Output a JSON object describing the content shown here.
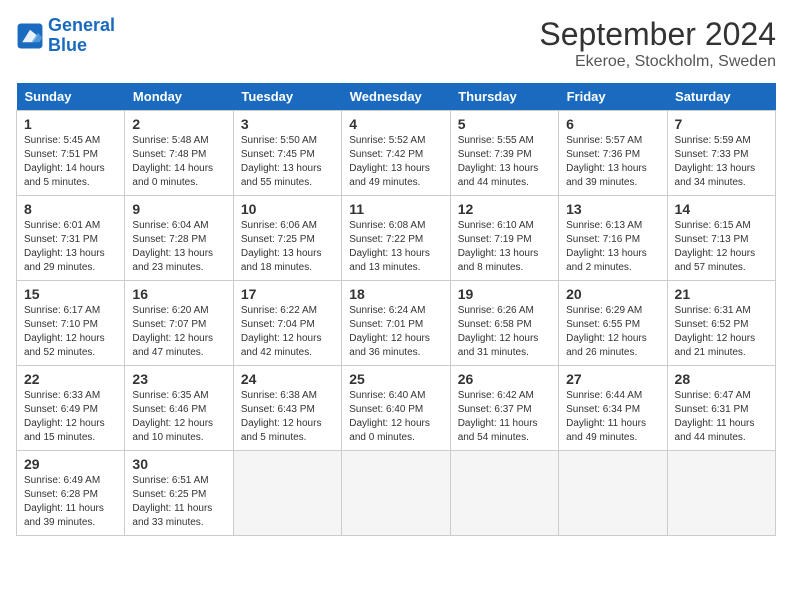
{
  "logo": {
    "line1": "General",
    "line2": "Blue"
  },
  "title": "September 2024",
  "location": "Ekeroe, Stockholm, Sweden",
  "days_of_week": [
    "Sunday",
    "Monday",
    "Tuesday",
    "Wednesday",
    "Thursday",
    "Friday",
    "Saturday"
  ],
  "weeks": [
    [
      {
        "num": "1",
        "sunrise": "5:45 AM",
        "sunset": "7:51 PM",
        "daylight": "14 hours and 5 minutes."
      },
      {
        "num": "2",
        "sunrise": "5:48 AM",
        "sunset": "7:48 PM",
        "daylight": "14 hours and 0 minutes."
      },
      {
        "num": "3",
        "sunrise": "5:50 AM",
        "sunset": "7:45 PM",
        "daylight": "13 hours and 55 minutes."
      },
      {
        "num": "4",
        "sunrise": "5:52 AM",
        "sunset": "7:42 PM",
        "daylight": "13 hours and 49 minutes."
      },
      {
        "num": "5",
        "sunrise": "5:55 AM",
        "sunset": "7:39 PM",
        "daylight": "13 hours and 44 minutes."
      },
      {
        "num": "6",
        "sunrise": "5:57 AM",
        "sunset": "7:36 PM",
        "daylight": "13 hours and 39 minutes."
      },
      {
        "num": "7",
        "sunrise": "5:59 AM",
        "sunset": "7:33 PM",
        "daylight": "13 hours and 34 minutes."
      }
    ],
    [
      {
        "num": "8",
        "sunrise": "6:01 AM",
        "sunset": "7:31 PM",
        "daylight": "13 hours and 29 minutes."
      },
      {
        "num": "9",
        "sunrise": "6:04 AM",
        "sunset": "7:28 PM",
        "daylight": "13 hours and 23 minutes."
      },
      {
        "num": "10",
        "sunrise": "6:06 AM",
        "sunset": "7:25 PM",
        "daylight": "13 hours and 18 minutes."
      },
      {
        "num": "11",
        "sunrise": "6:08 AM",
        "sunset": "7:22 PM",
        "daylight": "13 hours and 13 minutes."
      },
      {
        "num": "12",
        "sunrise": "6:10 AM",
        "sunset": "7:19 PM",
        "daylight": "13 hours and 8 minutes."
      },
      {
        "num": "13",
        "sunrise": "6:13 AM",
        "sunset": "7:16 PM",
        "daylight": "13 hours and 2 minutes."
      },
      {
        "num": "14",
        "sunrise": "6:15 AM",
        "sunset": "7:13 PM",
        "daylight": "12 hours and 57 minutes."
      }
    ],
    [
      {
        "num": "15",
        "sunrise": "6:17 AM",
        "sunset": "7:10 PM",
        "daylight": "12 hours and 52 minutes."
      },
      {
        "num": "16",
        "sunrise": "6:20 AM",
        "sunset": "7:07 PM",
        "daylight": "12 hours and 47 minutes."
      },
      {
        "num": "17",
        "sunrise": "6:22 AM",
        "sunset": "7:04 PM",
        "daylight": "12 hours and 42 minutes."
      },
      {
        "num": "18",
        "sunrise": "6:24 AM",
        "sunset": "7:01 PM",
        "daylight": "12 hours and 36 minutes."
      },
      {
        "num": "19",
        "sunrise": "6:26 AM",
        "sunset": "6:58 PM",
        "daylight": "12 hours and 31 minutes."
      },
      {
        "num": "20",
        "sunrise": "6:29 AM",
        "sunset": "6:55 PM",
        "daylight": "12 hours and 26 minutes."
      },
      {
        "num": "21",
        "sunrise": "6:31 AM",
        "sunset": "6:52 PM",
        "daylight": "12 hours and 21 minutes."
      }
    ],
    [
      {
        "num": "22",
        "sunrise": "6:33 AM",
        "sunset": "6:49 PM",
        "daylight": "12 hours and 15 minutes."
      },
      {
        "num": "23",
        "sunrise": "6:35 AM",
        "sunset": "6:46 PM",
        "daylight": "12 hours and 10 minutes."
      },
      {
        "num": "24",
        "sunrise": "6:38 AM",
        "sunset": "6:43 PM",
        "daylight": "12 hours and 5 minutes."
      },
      {
        "num": "25",
        "sunrise": "6:40 AM",
        "sunset": "6:40 PM",
        "daylight": "12 hours and 0 minutes."
      },
      {
        "num": "26",
        "sunrise": "6:42 AM",
        "sunset": "6:37 PM",
        "daylight": "11 hours and 54 minutes."
      },
      {
        "num": "27",
        "sunrise": "6:44 AM",
        "sunset": "6:34 PM",
        "daylight": "11 hours and 49 minutes."
      },
      {
        "num": "28",
        "sunrise": "6:47 AM",
        "sunset": "6:31 PM",
        "daylight": "11 hours and 44 minutes."
      }
    ],
    [
      {
        "num": "29",
        "sunrise": "6:49 AM",
        "sunset": "6:28 PM",
        "daylight": "11 hours and 39 minutes."
      },
      {
        "num": "30",
        "sunrise": "6:51 AM",
        "sunset": "6:25 PM",
        "daylight": "11 hours and 33 minutes."
      },
      null,
      null,
      null,
      null,
      null
    ]
  ]
}
